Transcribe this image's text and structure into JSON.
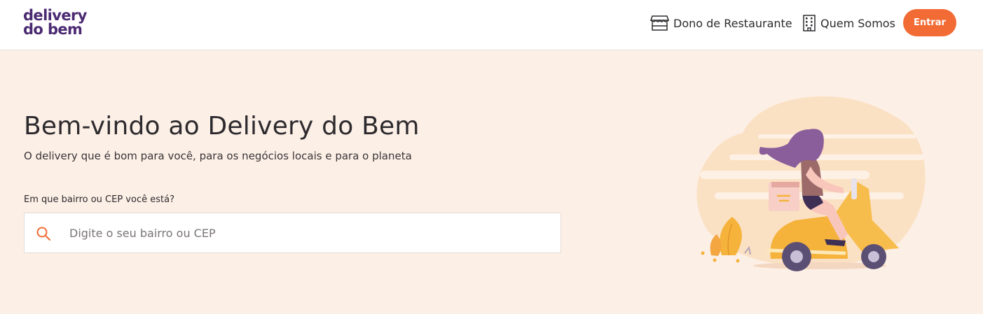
{
  "header": {
    "logo": {
      "line1": "delivery",
      "line2": "do bem"
    },
    "nav": [
      {
        "label": "Dono de Restaurante",
        "icon": "storefront-icon"
      },
      {
        "label": "Quem Somos",
        "icon": "building-icon"
      }
    ],
    "login_label": "Entrar"
  },
  "hero": {
    "title": "Bem-vindo ao Delivery do Bem",
    "subtitle": "O delivery que é bom para você, para os negócios locais e para o planeta",
    "search": {
      "label": "Em que bairro ou CEP você está?",
      "placeholder": "Digite o seu bairro ou CEP",
      "value": "",
      "icon": "search-icon"
    },
    "illustration": "scooter-delivery-illustration"
  },
  "colors": {
    "brand_purple": "#4b2a72",
    "accent_orange": "#f26b35",
    "hero_background": "#fcefe6",
    "scooter_yellow": "#f5b33c"
  }
}
